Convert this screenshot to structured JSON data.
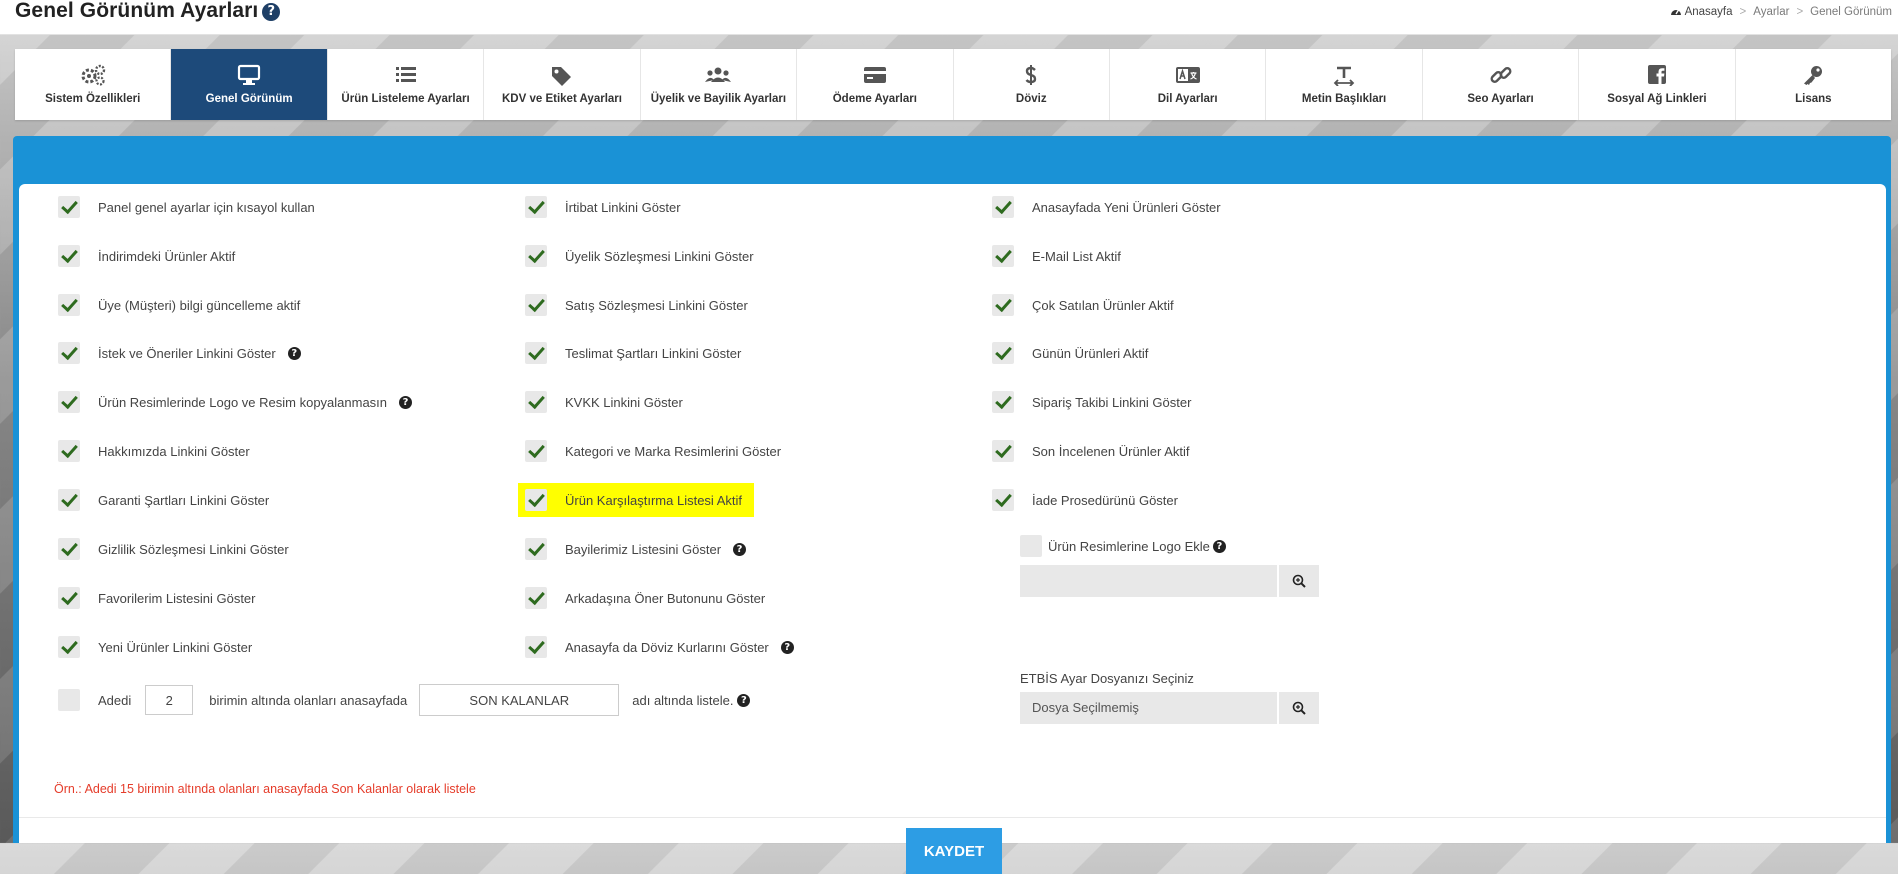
{
  "header": {
    "title": "Genel Görünüm Ayarları",
    "help_glyph": "?",
    "breadcrumb": [
      "Anasayfa",
      "Ayarlar",
      "Genel Görünüm"
    ],
    "breadcrumb_sep": ">"
  },
  "tabs": [
    {
      "label": "Sistem Özellikleri",
      "icon": "gears-icon"
    },
    {
      "label": "Genel Görünüm",
      "icon": "monitor-icon",
      "active": true
    },
    {
      "label": "Ürün Listeleme Ayarları",
      "icon": "list-icon"
    },
    {
      "label": "KDV ve Etiket Ayarları",
      "icon": "tags-icon"
    },
    {
      "label": "Üyelik ve Bayilik Ayarları",
      "icon": "users-icon"
    },
    {
      "label": "Ödeme Ayarları",
      "icon": "credit-card-icon"
    },
    {
      "label": "Döviz",
      "icon": "dollar-icon"
    },
    {
      "label": "Dil Ayarları",
      "icon": "language-icon"
    },
    {
      "label": "Metin Başlıkları",
      "icon": "text-height-icon"
    },
    {
      "label": "Seo Ayarları",
      "icon": "link-icon"
    },
    {
      "label": "Sosyal Ağ Linkleri",
      "icon": "facebook-icon"
    },
    {
      "label": "Lisans",
      "icon": "key-icon"
    }
  ],
  "options": {
    "col1": [
      {
        "label": "Panel genel ayarlar için kısayol kullan",
        "checked": true
      },
      {
        "label": "İndirimdeki Ürünler Aktif",
        "checked": true
      },
      {
        "label": "Üye (Müşteri) bilgi güncelleme aktif",
        "checked": true
      },
      {
        "label": "İstek ve Öneriler Linkini Göster",
        "checked": true,
        "help": true
      },
      {
        "label": "Ürün Resimlerinde Logo ve Resim kopyalanmasın",
        "checked": true,
        "help": true
      },
      {
        "label": "Hakkımızda Linkini Göster",
        "checked": true
      },
      {
        "label": "Garanti Şartları Linkini Göster",
        "checked": true
      },
      {
        "label": "Gizlilik Sözleşmesi Linkini Göster",
        "checked": true
      },
      {
        "label": "Favorilerim Listesini Göster",
        "checked": true
      },
      {
        "label": "Yeni Ürünler Linkini Göster",
        "checked": true
      }
    ],
    "col2": [
      {
        "label": "İrtibat Linkini Göster",
        "checked": true
      },
      {
        "label": "Üyelik Sözleşmesi Linkini Göster",
        "checked": true
      },
      {
        "label": "Satış Sözleşmesi Linkini Göster",
        "checked": true
      },
      {
        "label": "Teslimat Şartları Linkini Göster",
        "checked": true
      },
      {
        "label": "KVKK Linkini Göster",
        "checked": true
      },
      {
        "label": "Kategori ve Marka Resimlerini Göster",
        "checked": true
      },
      {
        "label": "Ürün Karşılaştırma Listesi Aktif",
        "checked": true,
        "highlight": true
      },
      {
        "label": "Bayilerimiz Listesini Göster",
        "checked": true,
        "help": true
      },
      {
        "label": "Arkadaşına Öner Butonunu Göster",
        "checked": true
      },
      {
        "label": "Anasayfa da Döviz Kurlarını Göster",
        "checked": true,
        "help": true
      }
    ],
    "col3": [
      {
        "label": "Anasayfada Yeni Ürünleri Göster",
        "checked": true
      },
      {
        "label": "E-Mail List Aktif",
        "checked": true
      },
      {
        "label": "Çok Satılan Ürünler Aktif",
        "checked": true
      },
      {
        "label": "Günün Ürünleri Aktif",
        "checked": true
      },
      {
        "label": "Sipariş Takibi Linkini Göster",
        "checked": true
      },
      {
        "label": "Son İncelenen Ürünler Aktif",
        "checked": true
      },
      {
        "label": "İade Prosedürünü Göster",
        "checked": true
      }
    ]
  },
  "stock_row": {
    "checked": false,
    "prefix": "Adedi",
    "quantity": "2",
    "middle": "birimin altında olanları anasayfada",
    "list_name": "SON KALANLAR",
    "suffix": "adı altında listele."
  },
  "note": "Örn.: Adedi 15 birimin altında olanları anasayfada Son Kalanlar olarak listele",
  "logo_option": {
    "label": "Ürün Resimlerine Logo Ekle",
    "checked": false,
    "file_value": ""
  },
  "etbis": {
    "label": "ETBİS Ayar Dosyanızı Seçiniz",
    "file_value": "Dosya Seçilmemiş"
  },
  "save_label": "KAYDET",
  "colors": {
    "accent": "#1a92d6",
    "active_tab": "#1d4a7a",
    "button": "#2d9de4",
    "highlight": "#ffff00",
    "note": "#e53c2a",
    "check": "#2e6b1f"
  }
}
